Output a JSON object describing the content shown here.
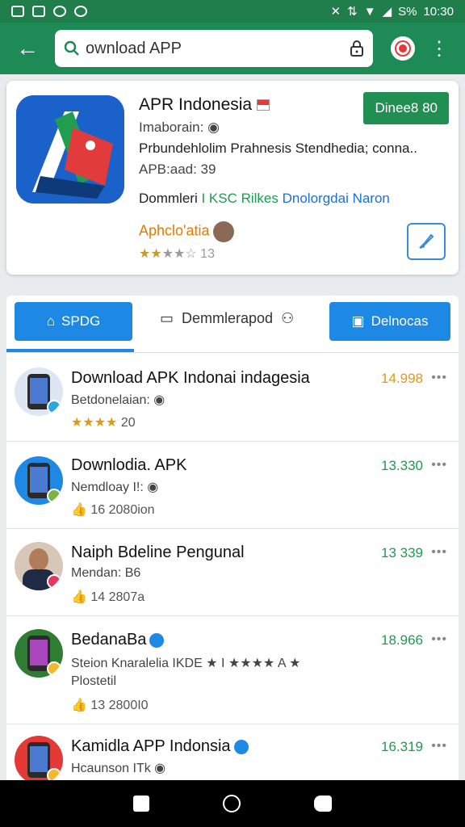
{
  "status_bar": {
    "battery": "S%",
    "time": "10:30"
  },
  "search": {
    "query": "ownload APP"
  },
  "featured": {
    "title": "APR Indonesia",
    "badge": "Dinee8 80",
    "line1": "Imaborain:",
    "line2": "Prbundehlolim Prahnesis Stendhedia; conna..",
    "line3": "APB:aad: 39",
    "downloads_label": "Dommleri",
    "downloads_green": "I KSC Rilkes",
    "downloads_blue": "Dnolorgdai Naron",
    "author": "Aphclo'atia",
    "rating": "13"
  },
  "tabs": {
    "tab1": "SPDG",
    "tab2": "Demmlerapod",
    "tab3": "Delnocas"
  },
  "list": [
    {
      "name": "Download APK Indonai indagesia",
      "sub": "Betdonelaian:",
      "meta": "20",
      "price": "14.998",
      "price_color": "gold"
    },
    {
      "name": "Downlodia. APK",
      "sub": "Nemdloay I!:",
      "meta": "16   2080ion",
      "price": "13.330",
      "price_color": "green"
    },
    {
      "name": "Naiph Bdeline Pengunal",
      "sub": "Mendan: B6",
      "meta": "14   2807a",
      "price": "13 339",
      "price_color": "green"
    },
    {
      "name": "BedanaBa",
      "sub": "Steion Knaralelia IKDE",
      "sub2": "Plostetil",
      "meta": "13   2800I0",
      "price": "18.966",
      "price_color": "green"
    },
    {
      "name": "Kamidla APP Indonsia",
      "sub": "Hcaunson ITk",
      "meta": "",
      "price": "16.319",
      "price_color": "green"
    }
  ]
}
